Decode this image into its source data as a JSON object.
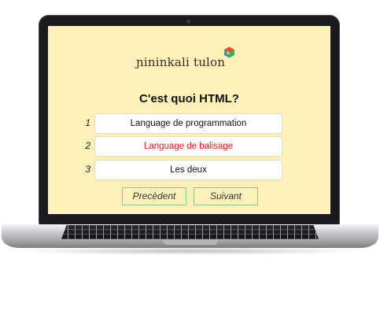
{
  "app": {
    "logo_text": "ninkali tulon",
    "logo_first_letter": "ɲi"
  },
  "quiz": {
    "question": "C'est quoi HTML?",
    "options": [
      {
        "number": "1",
        "label": "Language de programmation",
        "selected": false
      },
      {
        "number": "2",
        "label": "Language de balisage",
        "selected": true
      },
      {
        "number": "3",
        "label": "Les deux",
        "selected": false
      }
    ],
    "selected_color": "#e21b1b"
  },
  "navigation": {
    "previous_label": "Precèdent",
    "next_label": "Suivant"
  },
  "colors": {
    "screen_background": "#fdf1ba",
    "button_border": "#8fc49a"
  }
}
